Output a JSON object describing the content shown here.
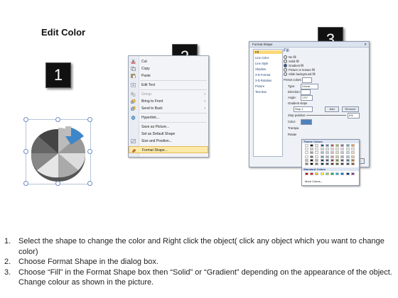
{
  "title": "Edit Color",
  "steps_badges": [
    "1",
    "2",
    "3"
  ],
  "context_menu": {
    "items": [
      {
        "label": "Cut",
        "icon": "scissors-icon",
        "disabled": false,
        "arrow": false
      },
      {
        "label": "Copy",
        "icon": "copy-icon",
        "disabled": false,
        "arrow": false
      },
      {
        "label": "Paste",
        "icon": "paste-icon",
        "disabled": false,
        "arrow": false
      },
      {
        "label": "Edit Text",
        "icon": "edit-text-icon",
        "disabled": false,
        "arrow": false
      },
      {
        "label": "Group",
        "icon": "group-icon",
        "disabled": true,
        "arrow": true
      },
      {
        "label": "Bring to Front",
        "icon": "bring-front-icon",
        "disabled": false,
        "arrow": true
      },
      {
        "label": "Send to Back",
        "icon": "send-back-icon",
        "disabled": false,
        "arrow": true
      },
      {
        "label": "Hyperlink...",
        "icon": "hyperlink-icon",
        "disabled": false,
        "arrow": false
      },
      {
        "label": "Save as Picture...",
        "icon": "",
        "disabled": false,
        "arrow": false
      },
      {
        "label": "Set as Default Shape",
        "icon": "",
        "disabled": false,
        "arrow": false
      },
      {
        "label": "Size and Position...",
        "icon": "size-icon",
        "disabled": false,
        "arrow": false
      },
      {
        "label": "Format Shape...",
        "icon": "format-shape-icon",
        "disabled": false,
        "arrow": false,
        "highlighted": true
      }
    ]
  },
  "dialog": {
    "title": "Format Shape",
    "sidebar": [
      "Fill",
      "Line Color",
      "Line Style",
      "Shadow",
      "3-D Format",
      "3-D Rotation",
      "Picture",
      "Text Box"
    ],
    "pane_title": "Fill",
    "options": [
      "No fill",
      "Solid fill",
      "Gradient fill",
      "Picture or texture fill",
      "Slide background fill"
    ],
    "selected_option": "Gradient fill",
    "preset_label": "Preset colors:",
    "type_label": "Type:",
    "type_value": "Linear",
    "direction_label": "Direction:",
    "angle_label": "Angle:",
    "angle_value": "170°",
    "gradient_stops_label": "Gradient stops",
    "stop_value": "Stop 1",
    "add_label": "Add",
    "remove_label": "Remove",
    "stop_position_label": "Stop position:",
    "stop_position_value": "0%",
    "color_label": "Color:",
    "transparency_label": "Transpa",
    "rotate_label": "Rotate",
    "close_label": "Close"
  },
  "palette": {
    "theme_label": "Theme Colors",
    "standard_label": "Standard Colors",
    "more_label": "More Colors...",
    "theme_top": [
      "#ffffff",
      "#000000",
      "#eeece1",
      "#1f497d",
      "#4f81bd",
      "#c0504d",
      "#9bbb59",
      "#8064a2",
      "#4bacc6",
      "#f79646"
    ],
    "standard": [
      "#c00000",
      "#ff0000",
      "#ffc000",
      "#ffff00",
      "#92d050",
      "#00b050",
      "#00b0f0",
      "#0070c0",
      "#002060",
      "#7030a0"
    ]
  },
  "instructions": [
    {
      "num": "1.",
      "text": "Select the shape to change the color and Right click the object( click any object which you want to change color)"
    },
    {
      "num": "2.",
      "text": "Choose Format Shape in the dialog box."
    },
    {
      "num": "3.",
      "text": "Choose “Fill” in the Format Shape box then “Solid” or “Gradient” depending on the appearance of the object. Change colour as shown in the picture."
    }
  ]
}
